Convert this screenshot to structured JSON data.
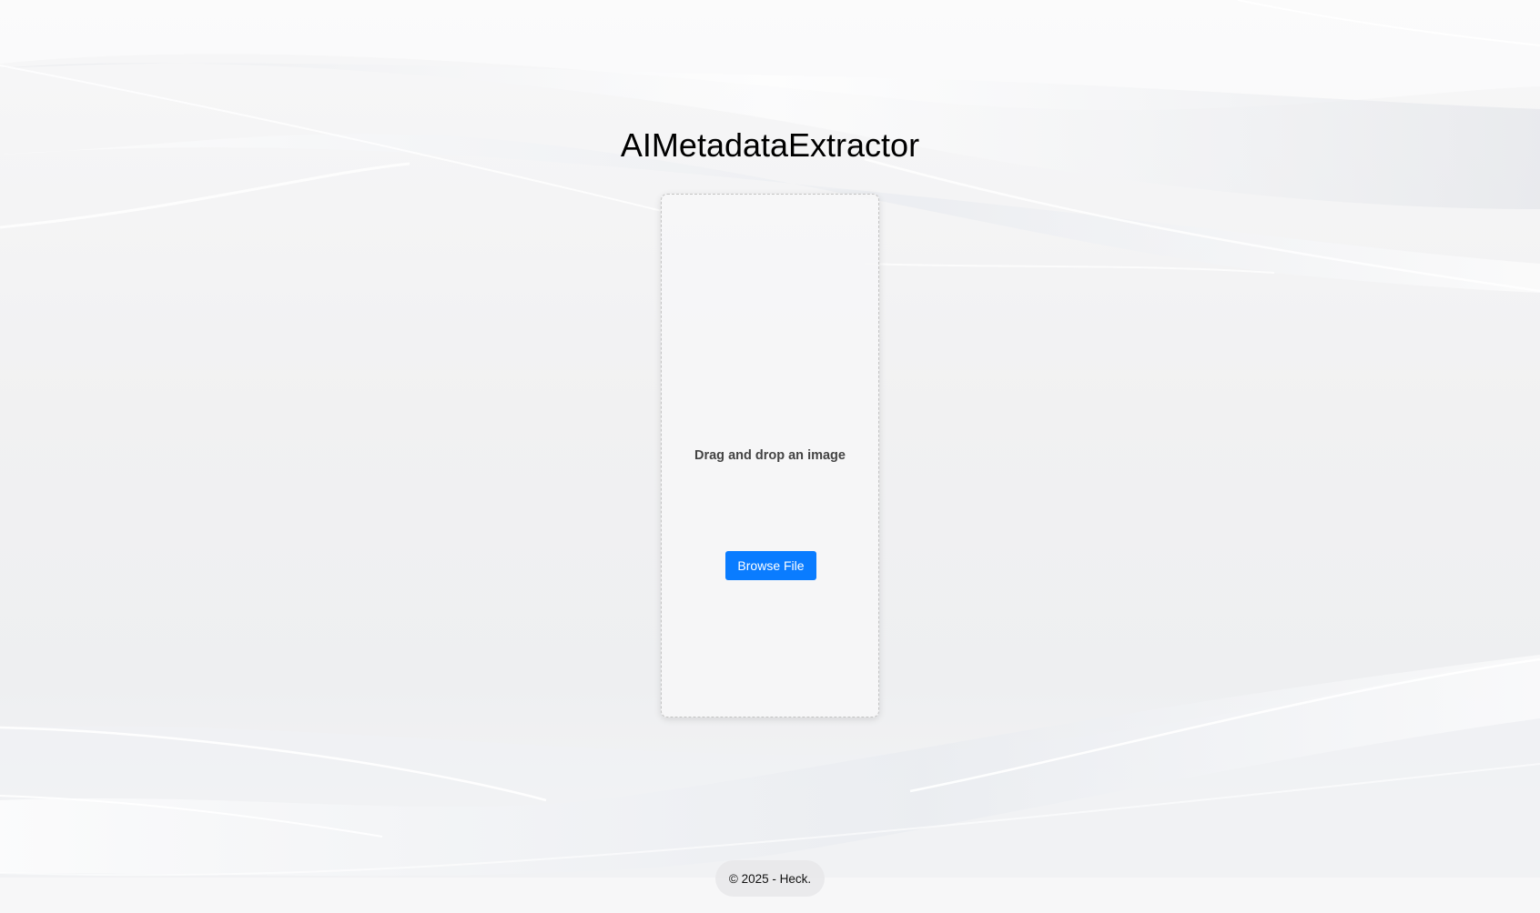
{
  "header": {
    "title": "AIMetadataExtractor"
  },
  "upload": {
    "instruction": "Drag and drop an image",
    "browse_label": "Browse File"
  },
  "footer": {
    "copyright": "© 2025 - Heck."
  },
  "colors": {
    "accent": "#0a7cff",
    "background": "#f2f2f3"
  }
}
